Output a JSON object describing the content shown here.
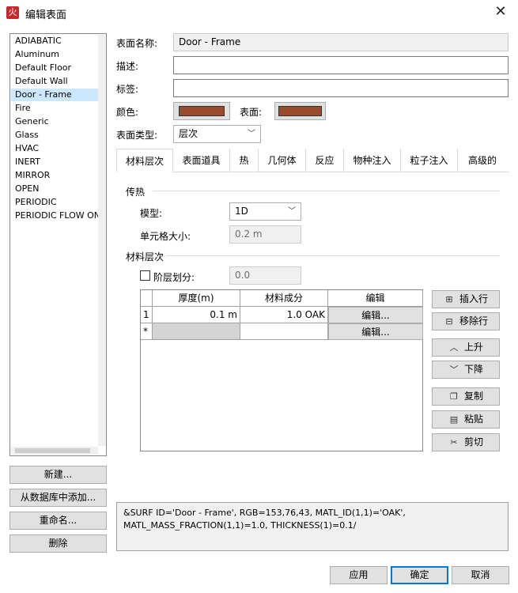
{
  "window": {
    "title": "编辑表面",
    "app_icon_glyph": "火"
  },
  "surfaces": {
    "items": [
      "ADIABATIC",
      "Aluminum",
      "Default Floor",
      "Default Wall",
      "Door - Frame",
      "Fire",
      "Generic",
      "Glass",
      "HVAC",
      "INERT",
      "MIRROR",
      "OPEN",
      "PERIODIC",
      "PERIODIC FLOW ONLY"
    ],
    "selected": "Door - Frame"
  },
  "left_buttons": {
    "new": "新建...",
    "add_from_db": "从数据库中添加...",
    "rename": "重命名...",
    "delete": "删除"
  },
  "form": {
    "name_label": "表面名称:",
    "name_value": "Door - Frame",
    "desc_label": "描述:",
    "desc_value": "",
    "tag_label": "标签:",
    "tag_value": "",
    "color_label": "颜色:",
    "surface_label": "表面:",
    "color_hex": "#994c2b",
    "surface_hex": "#994c2b",
    "type_label": "表面类型:",
    "type_value": "层次"
  },
  "tabs": [
    "材料层次",
    "表面道具",
    "热",
    "几何体",
    "反应",
    "物种注入",
    "粒子注入",
    "高级的"
  ],
  "active_tab": "材料层次",
  "heat": {
    "group_title": "传热",
    "model_label": "模型:",
    "model_value": "1D",
    "cell_size_label": "单元格大小:",
    "cell_size_value": "0.2 m"
  },
  "layers": {
    "group_title": "材料层次",
    "stratify_label": "阶层划分:",
    "stratify_checked": false,
    "stratify_value": "0.0",
    "columns": [
      "",
      "厚度(m)",
      "材料成分",
      "编辑"
    ],
    "rows": [
      {
        "index": "1",
        "thickness": "0.1 m",
        "composition": "1.0 OAK",
        "edit": "编辑..."
      },
      {
        "index": "*",
        "thickness": "",
        "composition": "",
        "edit": "编辑..."
      }
    ]
  },
  "side_buttons": {
    "insert_row": "插入行",
    "remove_row": "移除行",
    "up": "上升",
    "down": "下降",
    "copy": "复制",
    "paste": "粘贴",
    "cut": "剪切"
  },
  "fds_text": [
    "&SURF ID='Door - Frame', RGB=153,76,43, MATL_ID(1,1)='OAK',",
    "MATL_MASS_FRACTION(1,1)=1.0, THICKNESS(1)=0.1/"
  ],
  "bottom_buttons": {
    "apply": "应用",
    "ok": "确定",
    "cancel": "取消"
  }
}
